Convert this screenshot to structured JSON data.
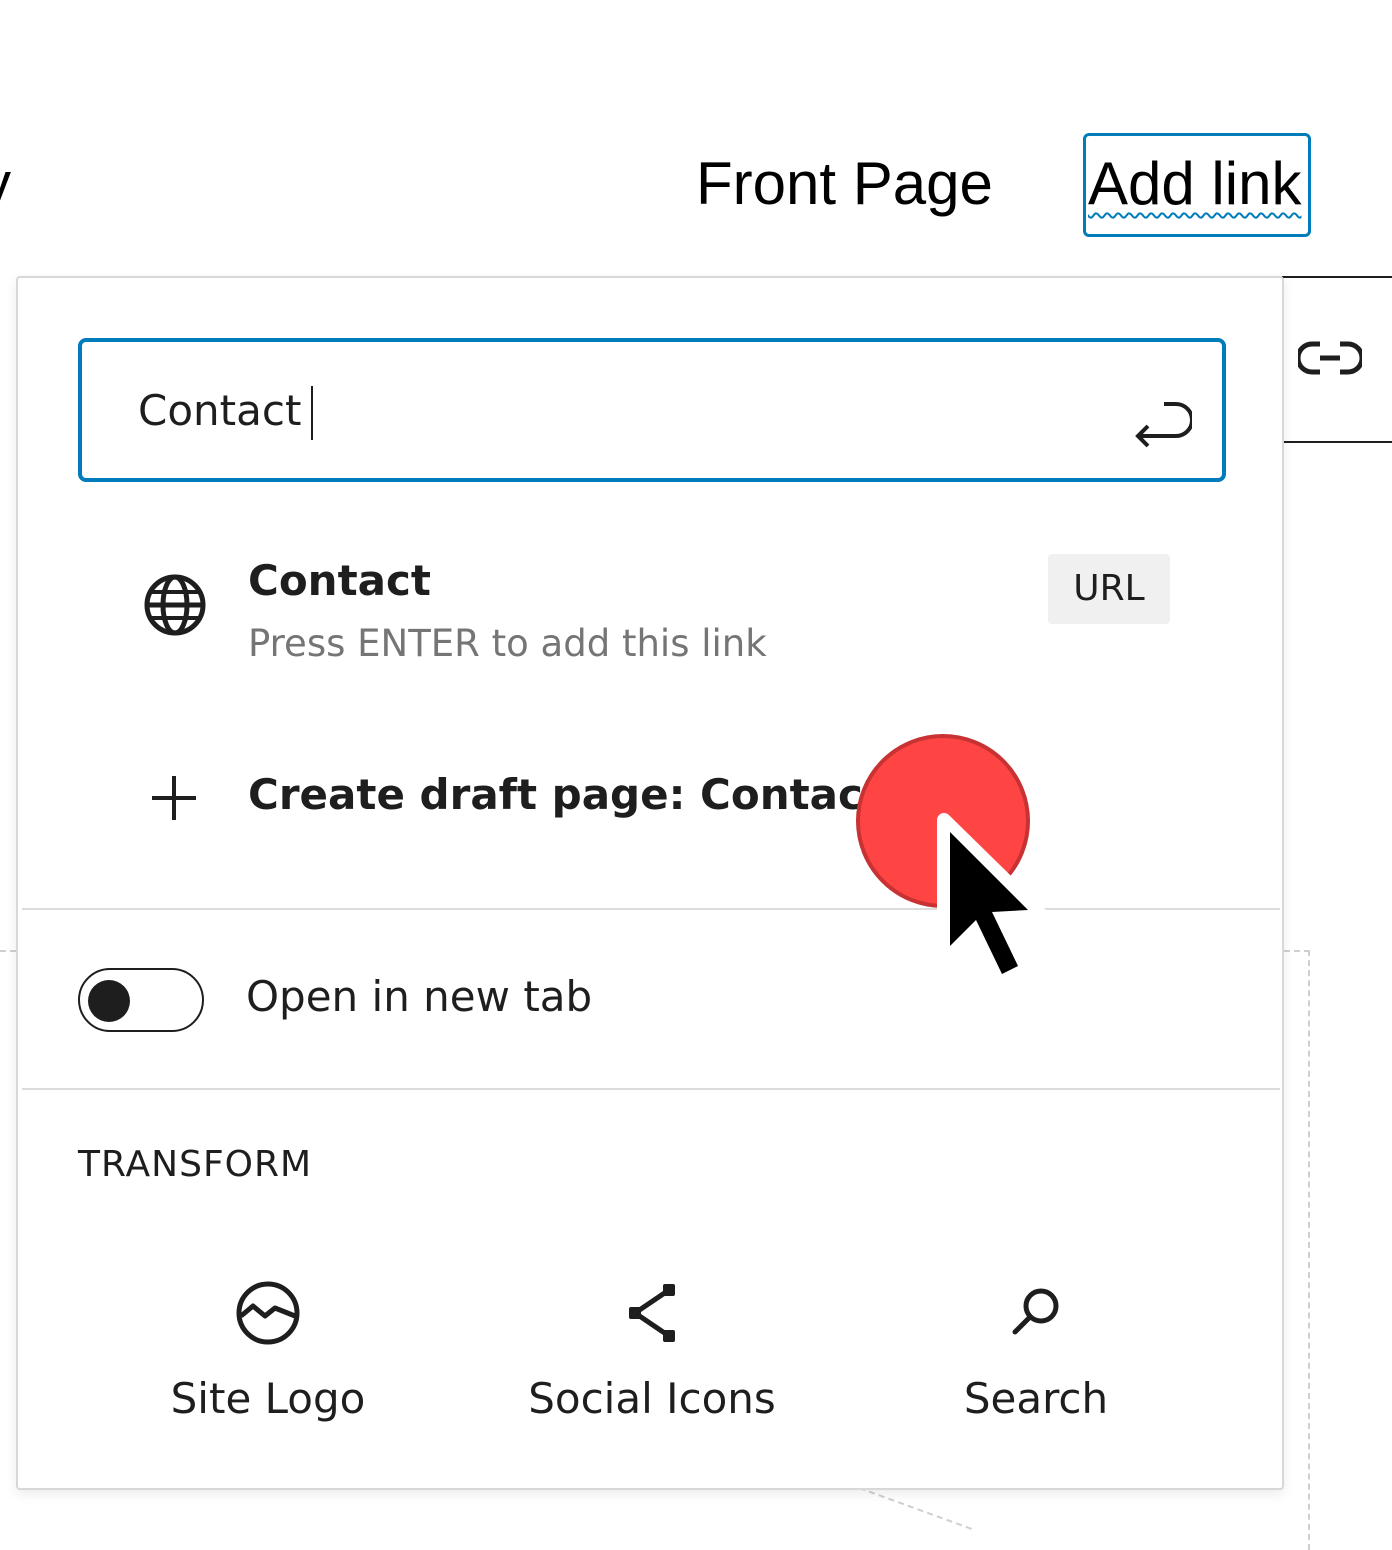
{
  "navigation": {
    "cut_item_char": "y",
    "front_page_label": "Front Page",
    "add_link_label": "Add link"
  },
  "link_popover": {
    "search": {
      "value": "Contact",
      "placeholder": ""
    },
    "suggestion": {
      "title": "Contact",
      "subtitle": "Press ENTER to add this link",
      "badge": "URL",
      "icon": "globe-icon"
    },
    "create_draft": {
      "prefix": "Create draft page: ",
      "name": "Contact",
      "icon": "plus-icon"
    },
    "open_in_new_tab": {
      "label": "Open in new tab",
      "enabled": false
    }
  },
  "transform": {
    "title": "TRANSFORM",
    "items": [
      {
        "label": "Site Logo",
        "icon": "site-logo-icon"
      },
      {
        "label": "Social Icons",
        "icon": "share-icon"
      },
      {
        "label": "Search",
        "icon": "search-icon"
      }
    ]
  },
  "colors": {
    "accent": "#007cba",
    "text": "#1e1e1e",
    "muted": "#757575",
    "badge_bg": "#f0f0f0",
    "click_marker": "#ff4444"
  }
}
